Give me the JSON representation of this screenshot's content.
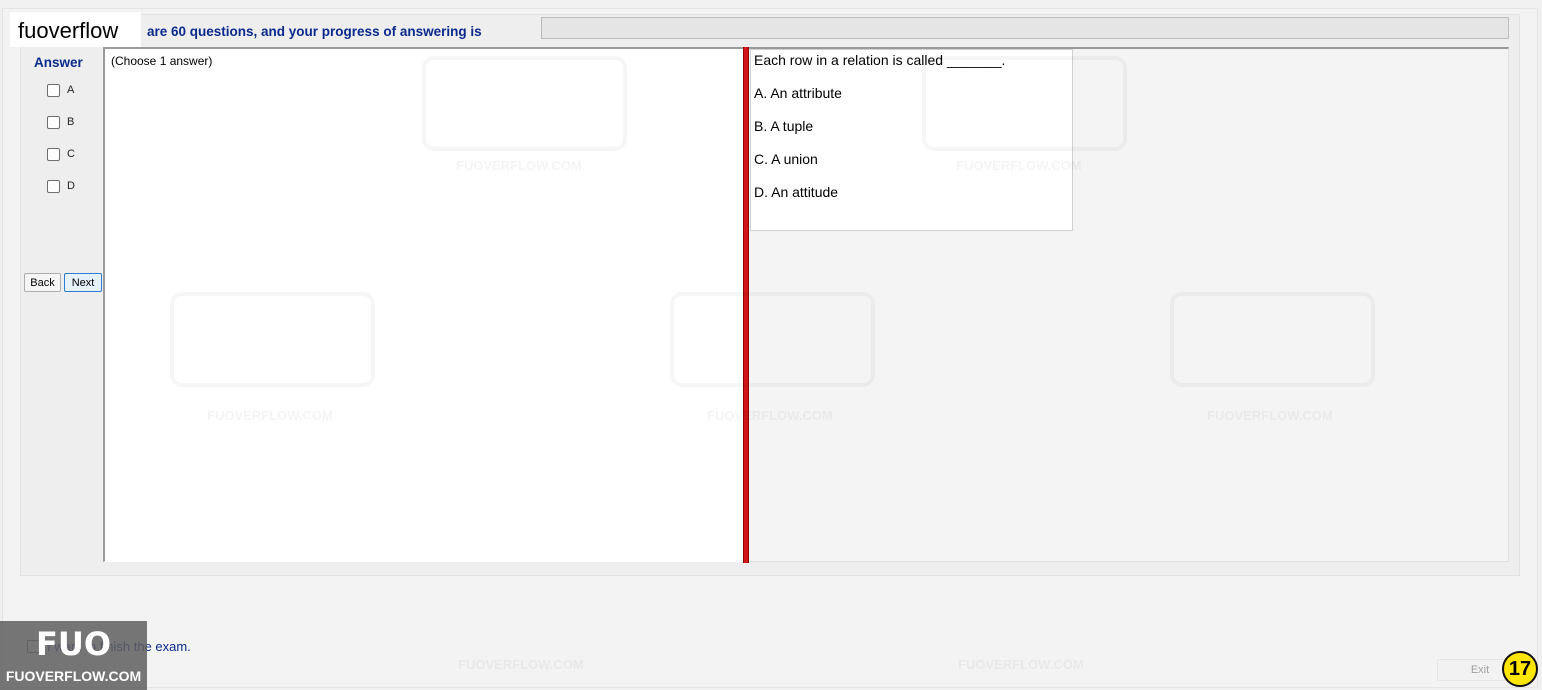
{
  "header": {
    "progress_text": "are 60 questions, and your progress of answering is",
    "progress_fraction": 0
  },
  "brand": {
    "label": "fuoverflow"
  },
  "answer": {
    "heading": "Answer",
    "choose_note": "(Choose 1 answer)",
    "options": [
      "A",
      "B",
      "C",
      "D"
    ]
  },
  "nav": {
    "back_label": "Back",
    "next_label": "Next"
  },
  "question": {
    "text": "Each row in a relation is called _______.",
    "options": [
      "A.  An attribute",
      "B.  A tuple",
      "C.  A union",
      "D.  An attitude"
    ]
  },
  "footer": {
    "finish_label": "I want to finish the exam.",
    "exit_label": "Exit",
    "page_number": "17"
  },
  "watermark": {
    "logo_text": "FUO",
    "site_text": "FUOVERFLOW.COM"
  },
  "colors": {
    "label_blue": "#0a2a8c",
    "splitter_red": "#d01616",
    "badge_yellow": "#ffe600"
  }
}
